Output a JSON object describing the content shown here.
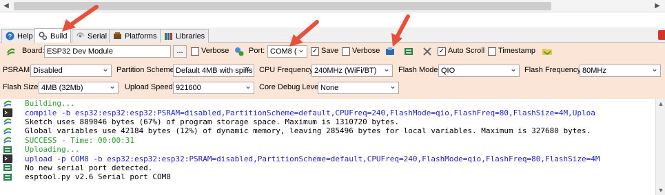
{
  "tabs": [
    {
      "label": "Help",
      "icon": "help-icon"
    },
    {
      "label": "Build",
      "icon": "build-icon"
    },
    {
      "label": "Serial",
      "icon": "serial-icon"
    },
    {
      "label": "Platforms",
      "icon": "platforms-icon"
    },
    {
      "label": "Libraries",
      "icon": "libraries-icon"
    }
  ],
  "toolbar": {
    "board_label": "Board:",
    "board_value": "ESP32 Dev Module",
    "browse_label": "...",
    "verbose_label": "Verbose",
    "port_label": "Port:",
    "port_value": "COM8 (",
    "save_label": "Save",
    "verbose2_label": "Verbose",
    "autoscroll_label": "Auto Scroll",
    "timestamp_label": "Timestamp"
  },
  "options": {
    "psram_label": "PSRAM:",
    "psram_value": "Disabled",
    "partition_label": "Partition Scheme:",
    "partition_value": "Default 4MB with spiffs",
    "cpu_label": "CPU Frequency:",
    "cpu_value": "240MHz (WiFi/BT)",
    "flashmode_label": "Flash Mode:",
    "flashmode_value": "QIO",
    "flashfreq_label": "Flash Frequency:",
    "flashfreq_value": "80MHz",
    "flashsize_label": "Flash Size:",
    "flashsize_value": "4MB (32Mb)",
    "upload_label": "Upload Speed:",
    "upload_value": "921600",
    "debug_label": "Core Debug Level:",
    "debug_value": "None"
  },
  "console": [
    {
      "text": "Building...",
      "color": "#2e9d2e",
      "icon": "gear-icon"
    },
    {
      "text": "compile -b esp32:esp32:esp32:PSRAM=disabled,PartitionScheme=default,CPUFreq=240,FlashMode=qio,FlashFreq=80,FlashSize=4M,Uploa",
      "color": "#1f1fbf",
      "icon": "terminal-icon"
    },
    {
      "text": "Sketch uses 889046 bytes (67%) of program storage space. Maximum is 1310720 bytes.",
      "color": "#000000",
      "icon": "gear-icon"
    },
    {
      "text": "Global variables use 42184 bytes (12%) of dynamic memory, leaving 285496 bytes for local variables. Maximum is 327680 bytes.",
      "color": "#000000",
      "icon": "gear-icon"
    },
    {
      "text": "SUCCESS - Time: 00:00:31",
      "color": "#2e9d2e",
      "icon": "gear-icon"
    },
    {
      "text": "Uploading...",
      "color": "#2e9d2e",
      "icon": "upload-icon"
    },
    {
      "text": "upload -p COM8 -b esp32:esp32:esp32:PSRAM=disabled,PartitionScheme=default,CPUFreq=240,FlashMode=qio,FlashFreq=80,FlashSize=4M",
      "color": "#1f1fbf",
      "icon": "terminal-icon"
    },
    {
      "text": "No new serial port detected.",
      "color": "#000000",
      "icon": "upload-icon"
    },
    {
      "text": "esptool.py v2.6  Serial port COM8",
      "color": "#000000",
      "icon": "upload-icon"
    }
  ],
  "colors": {
    "toolbar_bg": "#fbe5d6",
    "arrow": "#e8503a",
    "green": "#2e9d2e",
    "blue": "#1f1fbf"
  }
}
